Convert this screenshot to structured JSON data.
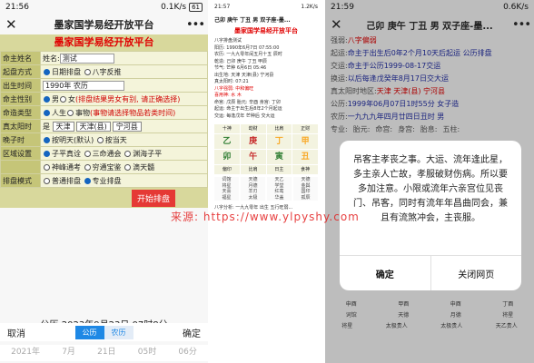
{
  "panel1": {
    "status": {
      "time": "21:56",
      "right": "0.1K/s",
      "battery": "61"
    },
    "nav": {
      "close": "✕",
      "title": "墨家国学易经开放平台",
      "more": "•••"
    },
    "brand": "墨家国学易经开放平台",
    "form": {
      "name_label": "命主姓名",
      "name_field_label": "姓名:",
      "name_value": "测试",
      "method_label": "起盘方式",
      "method_opt1": "日期排盘",
      "method_opt2": "八字反推",
      "year_label": "出生时间",
      "year_value": "1990年 农历",
      "gender_label": "命主性别",
      "gender_male": "男",
      "gender_female": "女",
      "gender_hint": "(排盘结果男女有别, 请正确选择)",
      "type_label": "命造类型",
      "type_person": "人生",
      "type_object": "事物",
      "type_hint": "(事物请选择物品若类时间)",
      "place_label": "真太阳时",
      "place_prefix": "是",
      "place_sel1": "天津",
      "place_sel2": "天津(县)",
      "place_sel3": "宁河县",
      "month_label": "晚子时",
      "month_opt1": "按明天(默认)",
      "month_opt2": "按当天",
      "region_label": "区域设置",
      "region_opt1": "子平真诠",
      "region_opt2": "三命通会",
      "region_opt3": "渊海子平",
      "region_opt4": "神峰通考",
      "region_opt5": "穷通宝鉴",
      "region_opt6": "滴天髓",
      "mode_label": "排盘模式",
      "mode_opt1": "普通排盘",
      "mode_opt2": "专业排盘",
      "start_button": "开始排盘"
    },
    "date_line": "公历:2023年9月23日 07时8分",
    "picker": {
      "cancel": "取消",
      "solar": "公历",
      "lunar": "农历",
      "confirm": "确定"
    },
    "picker_row": [
      "2021年",
      "7月",
      "21日",
      "05时",
      "06分"
    ]
  },
  "panel2": {
    "status": {
      "time": "21:57",
      "right": "1.2K/s"
    },
    "nav_title": "己卯 庚午 丁丑 男 双子座-墨...",
    "brand": "墨家国学易经开放平台",
    "info_lines": [
      "八字排盘测试",
      "阳历: 1990年6月7日 07:55:00",
      "农历: 一九九零年闰五月十五 辰时",
      "乾造: 己卯 庚午 丁丑 甲辰",
      "节气: 芒种 6月6日 05:46",
      "出生地: 天津 天津(县) 宁河县",
      "真太阳时: 07:21",
      "八字强弱: 中和偏旺",
      "喜用神: 水 木",
      "命宫: 戊辰 胎元: 辛酉 身宫: 丁卯",
      "起运: 命主于出生后8年2个月起运",
      "交运: 每逢戊年 芒种后 交大运"
    ],
    "grid_header": [
      "十神",
      "劫财",
      "比肩",
      "正财"
    ],
    "grid_top": [
      "乙",
      "庚",
      "丁",
      "甲"
    ],
    "grid_bottom": [
      "卯",
      "午",
      "寅",
      "丑"
    ],
    "grid_extra": [
      "偏印",
      "比肩",
      "日主",
      "食神"
    ],
    "cols": [
      "词馆\n将星\n天喜\n福星",
      "天德\n月德\n羊刃\n太极",
      "天乙\n学堂\n红鸾\n华盖",
      "天德\n金舆\n国印\n孤辰"
    ],
    "footer": "八字分析: 一九九零年 出生 五行旺弱..."
  },
  "panel3": {
    "status": {
      "time": "21:59",
      "right": "0.6K/s"
    },
    "nav": {
      "close": "✕",
      "title": "己卯 庚午 丁丑 男 双子座-墨...",
      "more": "•••"
    },
    "lines": [
      {
        "label": "强弱:",
        "value": "八字偏弱"
      },
      {
        "label": "起运:",
        "value": "命主于出生后0年2个月10天后起运 公历排盘"
      },
      {
        "label": "交运:",
        "value": "命主于公历1999-08-17交运"
      },
      {
        "label": "换运:",
        "value": "以后每逢戊癸年8月17日交大运"
      },
      {
        "label": "真太阳时地区:",
        "value": "天津 天津(县) 宁河县"
      },
      {
        "label": "公历:",
        "value": "1999年06月07日1时55分 女子造"
      },
      {
        "label": "农历:",
        "value": "一九九九年四月廿四日丑时 男"
      }
    ],
    "tags": [
      "专业:",
      "胎元:",
      "命宫:",
      "身宫:",
      "胎息:",
      "五柱:"
    ],
    "dialog": {
      "message": "吊客主孝丧之事。大运、流年逢此星，多主亲人亡故，孝服破财伤病。所以要多加注意。小限或流年六亲宫位见丧门、吊客，同时有流年年昌曲同会，兼且有流煞冲会，主丧服。",
      "ok": "确定",
      "cancel": "关闭网页"
    },
    "bottom_rows": [
      [
        "申酉",
        "甲酉",
        "申酉",
        "丁酉"
      ],
      [
        "词馆",
        "天德",
        "月德",
        "将星"
      ],
      [
        "将星",
        "太极贵人",
        "太极贵人",
        "天乙贵人"
      ]
    ]
  },
  "watermark": "来源: https://www.ylpyshy.com"
}
